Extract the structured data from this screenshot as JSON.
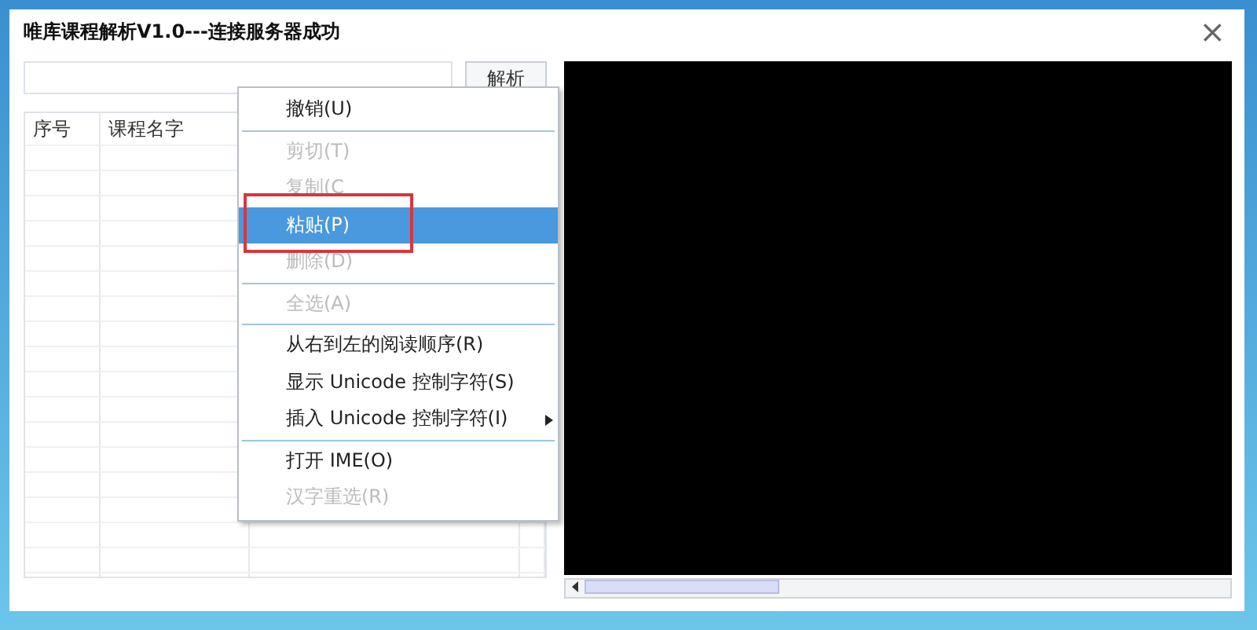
{
  "window": {
    "title": "唯库课程解析V1.0---连接服务器成功",
    "close": "×"
  },
  "parse_button": {
    "label": "解析"
  },
  "table": {
    "columns": [
      "序号",
      "课程名字"
    ]
  },
  "context_menu": {
    "items": [
      {
        "kind": "item",
        "label": "撤销(U)",
        "disabled": false,
        "selected": false
      },
      {
        "kind": "separator"
      },
      {
        "kind": "item",
        "label": "剪切(T)",
        "disabled": true,
        "selected": false
      },
      {
        "kind": "item",
        "label": "复制(C",
        "disabled": true,
        "selected": false
      },
      {
        "kind": "item",
        "label": "粘贴(P)",
        "disabled": false,
        "selected": true,
        "highlighted_frame": true
      },
      {
        "kind": "item",
        "label": "删除(D)",
        "disabled": true,
        "selected": false
      },
      {
        "kind": "separator"
      },
      {
        "kind": "item",
        "label": "全选(A)",
        "disabled": true,
        "selected": false
      },
      {
        "kind": "separator"
      },
      {
        "kind": "item",
        "label": "从右到左的阅读顺序(R)",
        "disabled": false,
        "selected": false
      },
      {
        "kind": "item",
        "label": "显示 Unicode 控制字符(S)",
        "disabled": false,
        "selected": false
      },
      {
        "kind": "item",
        "label": "插入 Unicode 控制字符(I)",
        "disabled": false,
        "selected": false,
        "submenu": true
      },
      {
        "kind": "separator"
      },
      {
        "kind": "item",
        "label": "打开 IME(O)",
        "disabled": false,
        "selected": false
      },
      {
        "kind": "item",
        "label": "汉字重选(R)",
        "disabled": true,
        "selected": false
      }
    ]
  }
}
